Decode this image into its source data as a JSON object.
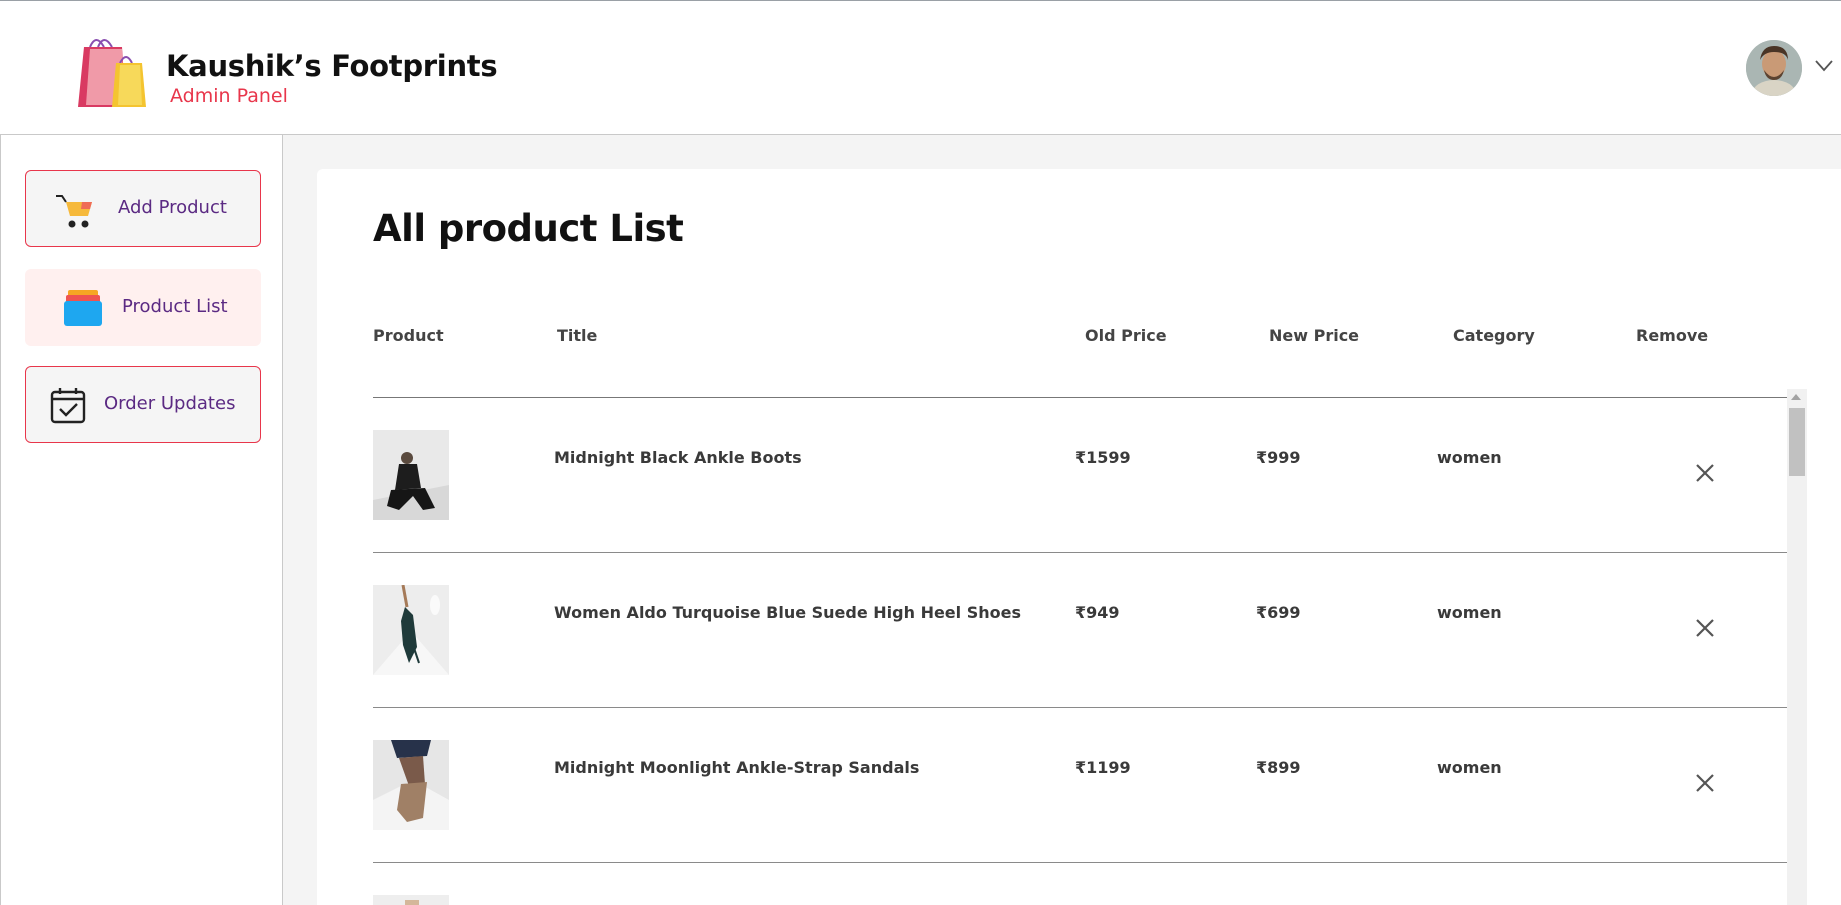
{
  "header": {
    "brand_title": "Kaushik’s Footprints",
    "brand_subtitle": "Admin Panel",
    "logo_bag_text": "Kaushik's Footprints",
    "accent_color": "#e8364b"
  },
  "sidebar": {
    "items": [
      {
        "label": "Add Product",
        "icon": "cart-icon"
      },
      {
        "label": "Product List",
        "icon": "product-list-icon"
      },
      {
        "label": "Order Updates",
        "icon": "calendar-check-icon"
      }
    ]
  },
  "main": {
    "title": "All product List",
    "columns": [
      "Product",
      "Title",
      "Old Price",
      "New Price",
      "Category",
      "Remove"
    ],
    "rows": [
      {
        "title": "Midnight Black Ankle Boots",
        "old_price": "₹1599",
        "new_price": "₹999",
        "category": "women"
      },
      {
        "title": "Women Aldo Turquoise Blue Suede High Heel Shoes",
        "old_price": "₹949",
        "new_price": "₹699",
        "category": "women"
      },
      {
        "title": "Midnight Moonlight Ankle-Strap Sandals",
        "old_price": "₹1199",
        "new_price": "₹899",
        "category": "women"
      }
    ]
  }
}
